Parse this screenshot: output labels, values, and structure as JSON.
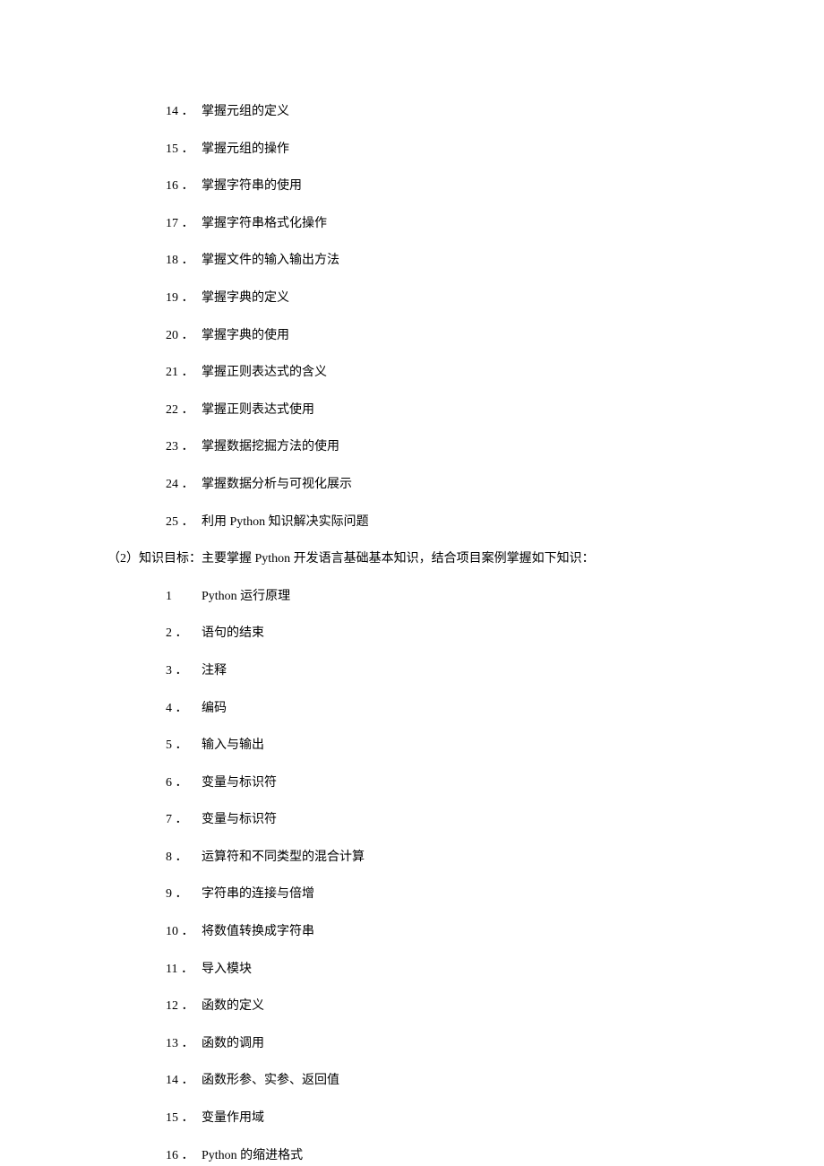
{
  "skillGoals": [
    {
      "num": "14 ．",
      "text": "掌握元组的定义"
    },
    {
      "num": "15 ．",
      "text": "掌握元组的操作"
    },
    {
      "num": "16 ．",
      "text": "掌握字符串的使用"
    },
    {
      "num": "17 ．",
      "text": "掌握字符串格式化操作"
    },
    {
      "num": "18 ．",
      "text": "掌握文件的输入输出方法"
    },
    {
      "num": "19 ．",
      "text": "掌握字典的定义"
    },
    {
      "num": "20 ．",
      "text": "掌握字典的使用"
    },
    {
      "num": "21 ．",
      "text": "掌握正则表达式的含义"
    },
    {
      "num": "22 ．",
      "text": "掌握正则表达式使用"
    },
    {
      "num": "23 ．",
      "text": "掌握数据挖掘方法的使用"
    },
    {
      "num": "24 ．",
      "text": "掌握数据分析与可视化展示"
    },
    {
      "num": "25 ．",
      "text": "利用 Python 知识解决实际问题"
    }
  ],
  "sectionHeading": "（2）知识目标：主要掌握 Python 开发语言基础基本知识，结合项目案例掌握如下知识：",
  "knowledgeGoals": [
    {
      "num": "1  ",
      "text": "Python 运行原理"
    },
    {
      "num": "2 ．",
      "text": "语句的结束"
    },
    {
      "num": "3 ．",
      "text": "注释"
    },
    {
      "num": "4 ．",
      "text": "编码"
    },
    {
      "num": "5 ．",
      "text": "输入与输出"
    },
    {
      "num": "6 ．",
      "text": "变量与标识符"
    },
    {
      "num": "7 ．",
      "text": "变量与标识符"
    },
    {
      "num": "8 ．",
      "text": "运算符和不同类型的混合计算"
    },
    {
      "num": "9 ．",
      "text": "字符串的连接与倍增"
    },
    {
      "num": "10 ．",
      "text": "将数值转换成字符串"
    },
    {
      "num": "11 ．",
      "text": "导入模块"
    },
    {
      "num": "12 ．",
      "text": "函数的定义"
    },
    {
      "num": "13 ．",
      "text": "函数的调用"
    },
    {
      "num": "14 ．",
      "text": "函数形参、实参、返回值"
    },
    {
      "num": "15 ．",
      "text": "变量作用域"
    },
    {
      "num": "16 ．",
      "text": "Python 的缩进格式"
    }
  ]
}
